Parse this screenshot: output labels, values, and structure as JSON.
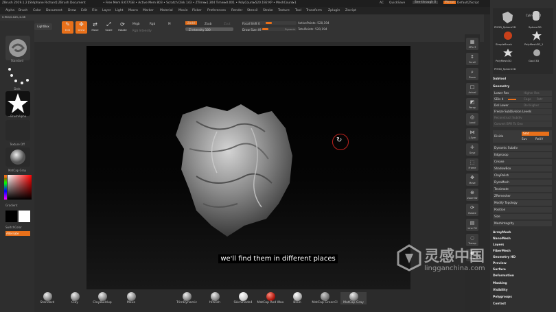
{
  "titlebar": {
    "left": "ZBrush 2019.1.2 [Stéphane Richard]   ZBrush Document",
    "stats": "• Free Mem 8.677GB • Active Mem 803 • Scratch Disk 143 • ZTime▸1.304 Timer▸0.001 • PolyCount▸520.192 KP • MeshCount▸1",
    "ac": "AC",
    "quicksave": "QuickSave",
    "seethrough": "See-through  0",
    "menus": "Menus",
    "script": "DefaultZScript"
  },
  "menubar": [
    "Alpha",
    "Brush",
    "Color",
    "Document",
    "Draw",
    "Edit",
    "File",
    "Layer",
    "Light",
    "Macro",
    "Marker",
    "Material",
    "Movie",
    "Picker",
    "Preferences",
    "Render",
    "Stencil",
    "Stroke",
    "Texture",
    "Tool",
    "Transform",
    "Zplugin",
    "Zscript"
  ],
  "coords": "0.904,0.025,-0.38",
  "shelf": {
    "projection_master": "Projection Master",
    "lightbox": "LightBox",
    "tools": [
      {
        "label": "Edit",
        "icon": "✎"
      },
      {
        "label": "Draw",
        "icon": "✥"
      },
      {
        "label": "Move",
        "icon": "⇄"
      },
      {
        "label": "Scale",
        "icon": "⤢"
      },
      {
        "label": "Rotate",
        "icon": "⟳"
      }
    ],
    "mrgb": "Mrgb",
    "rgb": "Rgb",
    "m": "M",
    "rgb_intensity": "Rgb Intensity",
    "zadd": "Zadd",
    "zsub": "Zsub",
    "zcut": "Zcut",
    "z_intensity": "Z Intensity 100",
    "focal_shift": "Focal Shift 0",
    "draw_size": "Draw Size 49",
    "dynamic": "Dynamic",
    "active_points": "ActivePoints: 520,194",
    "total_points": "TotalPoints: 520,194"
  },
  "left_tray": {
    "standard": "Standard",
    "dots": "Dots",
    "brush_alpha": "~BrushAlpha",
    "texture_off": "Texture Off",
    "matcap": "MatCap Gray",
    "gradient": "Gradient",
    "switch_color": "SwitchColor",
    "alternate": "Alternate"
  },
  "subtitle": "we'll find them in different places",
  "right_icons": [
    {
      "label": "SPix 3",
      "icon": "▦"
    },
    {
      "label": "Scroll",
      "icon": "↕"
    },
    {
      "label": "Zoom",
      "icon": "⌕"
    },
    {
      "label": "Actual",
      "icon": "□"
    },
    {
      "label": "AAHalf",
      "icon": "◧"
    },
    {
      "label": "Persp",
      "icon": "◩"
    },
    {
      "label": "Floor",
      "icon": "▭"
    },
    {
      "label": "Local",
      "icon": "◎"
    },
    {
      "label": "L.Sym",
      "icon": "⋈"
    },
    {
      "label": "Gxyz",
      "icon": "✛"
    },
    {
      "label": "Frame",
      "icon": "⬚"
    },
    {
      "label": "Move",
      "icon": "✥"
    },
    {
      "label": "Zoom3D",
      "icon": "⊕"
    },
    {
      "label": "Rotate",
      "icon": "⟳"
    },
    {
      "label": "Line Fill",
      "icon": "▤"
    },
    {
      "label": "Transp",
      "icon": "◌"
    },
    {
      "label": "Solo",
      "icon": "●"
    }
  ],
  "right_panel": {
    "tools": [
      "PM3D_Sphere3D",
      "Sphere3D",
      "SimpleBrush",
      "PolyMesh3D_1",
      "PolyMesh3D",
      "Goal 3D",
      "PM3D_Sphere3D"
    ],
    "cylinder": "Cylinder3D",
    "subtool": "Subtool",
    "geometry": "Geometry",
    "lower_res": "Lower Res",
    "higher_res": "Higher Res",
    "sdiv": "SDiv 4",
    "cage": "Cage",
    "rstr": "Rstr",
    "del_lower": "Del Lower",
    "del_higher": "Del Higher",
    "freeze": "Freeze SubDivision Levels",
    "reconstruct": "Reconstruct Subdiv",
    "convert_bpr": "Convert BPR To Geo",
    "divide": "Divide",
    "smt": "Smt",
    "suv": "Suv",
    "reuv": "ReUV",
    "items": [
      "Dynamic Subdiv",
      "EdgeLoop",
      "Crease",
      "ShadowBox",
      "ClayPolish",
      "DynaMesh",
      "Tessimate",
      "ZRemesher",
      "Modify Topology",
      "Position",
      "Size",
      "MeshIntegrity"
    ],
    "sections": [
      "ArrayMesh",
      "NanoMesh",
      "Layers",
      "FiberMesh",
      "Geometry HD",
      "Preview",
      "Surface",
      "Deformation",
      "Masking",
      "Visibility",
      "Polygroups",
      "Contact"
    ]
  },
  "bottom_brushes": [
    "Standard",
    "Clay",
    "ClayBuildup",
    "Move",
    "TrimDynamic",
    "hPolish",
    "SkinShade4",
    "MatCap Red Wax",
    "Bloin",
    "MatCap GreenCl",
    "MatCap Gray"
  ],
  "watermark": {
    "title": "灵感中国",
    "url": "lingganchina.com"
  },
  "colors": {
    "accent": "#e8701a",
    "panel": "#303030",
    "canvas": "#000000"
  }
}
